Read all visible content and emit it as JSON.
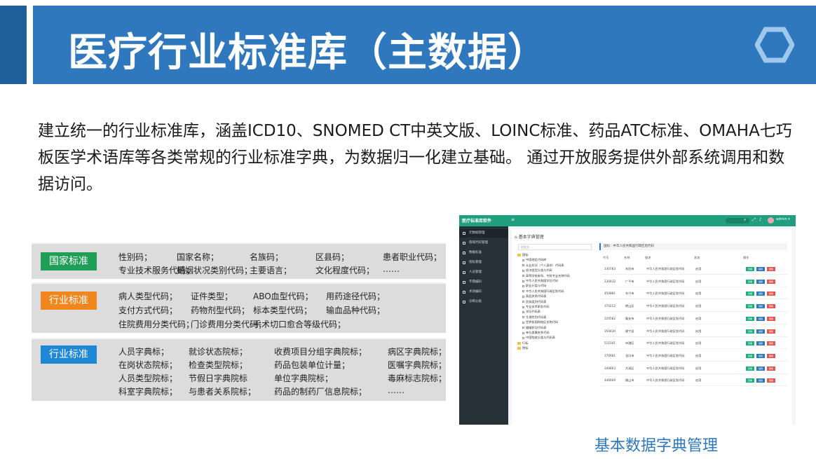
{
  "slide": {
    "title": "医疗行业标准库（主数据）",
    "intro": "建立统一的行业标准库，涵盖ICD10、SNOMED CT中英文版、LOINC标准、药品ATC标准、OMAHA七巧板医学术语库等各类常规的行业标准字典，为数据归一化建立基础。 通过开放服务提供外部系统调用和数据访问。",
    "caption": "基本数据字典管理",
    "accent_color": "#2f78bd",
    "dark_accent_color": "#1f5f99"
  },
  "standards": [
    {
      "badge": "国家标准",
      "badge_color": "#1f9f55",
      "rows": [
        [
          "性别码；",
          "国家名称；",
          "名族码；",
          "区县码；",
          "患者职业代码；"
        ],
        [
          "专业技术服务代码；",
          "婚姻状况类别代码；",
          "主要语言；",
          "文化程度代码；",
          "……"
        ]
      ]
    },
    {
      "badge": "行业标准",
      "badge_color": "#f0871e",
      "rows": [
        [
          "病人类型代码；",
          "证件类型；",
          "ABO血型代码；",
          "用药途径代码；"
        ],
        [
          "支付方式代码；",
          "药物剂型代码；",
          "标本类型代码；",
          "输血品种代码；"
        ],
        [
          "住院费用分类代码；",
          "门诊费用分类代码；",
          "手术切口愈合等级代码；"
        ]
      ]
    },
    {
      "badge": "行业标准",
      "badge_color": "#1e87d6",
      "rows": [
        [
          "人员字典标；",
          "就诊状态院标；",
          "收费项目分组字典院标；",
          "病区字典院标；"
        ],
        [
          "在岗状态院标；",
          "检查类型院标；",
          "药品包装单位计量；",
          "医嘱字典院标；"
        ],
        [
          "人员类型院标；",
          "节假日字典院标",
          "单位字典院标；",
          "毒麻标志院标；"
        ],
        [
          "科室字典院标；",
          "与患者关系院标；",
          "药品的制药厂信息院标；",
          "……"
        ]
      ]
    }
  ],
  "app": {
    "brand": "医疗标准库软件",
    "menu_toggle": "≡",
    "user": "admin ▾",
    "sidebar": [
      "元数据管理",
      "值域代码管理",
      "数据标准",
      "指标管理",
      "人员管理",
      "字典编码",
      "术语编码",
      "诊断分类"
    ],
    "main_title": "⌂ 基本字典管理",
    "tree_search_placeholder": "根据名…",
    "tree": [
      {
        "label": "国标",
        "kind": "folder"
      },
      {
        "label": "中国地区代码库",
        "kind": "leaf"
      },
      {
        "label": "从业状况（个人身份）代码表",
        "kind": "leaf"
      },
      {
        "label": "经济类型分类与代码",
        "kind": "leaf"
      },
      {
        "label": "高等学校本科、专科专业名称代码",
        "kind": "leaf"
      },
      {
        "label": "中华人民共和国学位代码",
        "kind": "leaf"
      },
      {
        "label": "职业分类与代码",
        "kind": "leaf"
      },
      {
        "label": "中华人民共和国行政区划代码",
        "kind": "leaf"
      },
      {
        "label": "家庭关系代码表",
        "kind": "leaf"
      },
      {
        "label": "民族类别代码表",
        "kind": "leaf"
      },
      {
        "label": "专业技术职务代码",
        "kind": "leaf"
      },
      {
        "label": "学历代码表",
        "kind": "leaf"
      },
      {
        "label": "生理性别代码表",
        "kind": "leaf"
      },
      {
        "label": "世界各国和地区名称代码",
        "kind": "leaf"
      },
      {
        "label": "婚姻状况代码表",
        "kind": "leaf"
      },
      {
        "label": "单位隶属关系代码",
        "kind": "leaf"
      },
      {
        "label": "中国残疾分类与代码表",
        "kind": "leaf"
      },
      {
        "label": "行标",
        "kind": "folder"
      },
      {
        "label": "院标",
        "kind": "folder"
      }
    ],
    "grid_title": "国标：中华人民共和国行政区划代码",
    "columns": [
      "代号",
      "名称",
      "描述",
      "状态",
      "操作"
    ],
    "rows": [
      {
        "code": "330783",
        "name": "东阳市",
        "desc": "中华人民共和国行政区划代码",
        "status": "启用"
      },
      {
        "code": "130432",
        "name": "广平市",
        "desc": "中华人民共和国行政区划代码",
        "status": "启用"
      },
      {
        "code": "450881",
        "name": "东兴市",
        "desc": "中华人民共和国行政区划代码",
        "status": "启用"
      },
      {
        "code": "370212",
        "name": "崂山区",
        "desc": "中华人民共和国行政区划代码",
        "status": "启用"
      },
      {
        "code": "220582",
        "name": "集安市",
        "desc": "中华人民共和国行政区划代码",
        "status": "启用"
      },
      {
        "code": "350430",
        "name": "建宁县",
        "desc": "中华人民共和国行政区划代码",
        "status": "启用"
      },
      {
        "code": "511501",
        "name": "市辖区",
        "desc": "中华人民共和国行政区划代码",
        "status": "启用"
      },
      {
        "code": "370681",
        "name": "龙口市",
        "desc": "中华人民共和国行政区划代码",
        "status": "启用"
      },
      {
        "code": "340803",
        "name": "大观区",
        "desc": "中华人民共和国行政区划代码",
        "status": "启用"
      },
      {
        "code": "440609",
        "name": "佛山市",
        "desc": "中华人民共和国行政区划代码",
        "status": "启用"
      }
    ],
    "row_actions": [
      "查看",
      "编辑",
      "删除"
    ],
    "action_colors": [
      "#1fae7d",
      "#2f78bd",
      "#e2554f"
    ]
  }
}
